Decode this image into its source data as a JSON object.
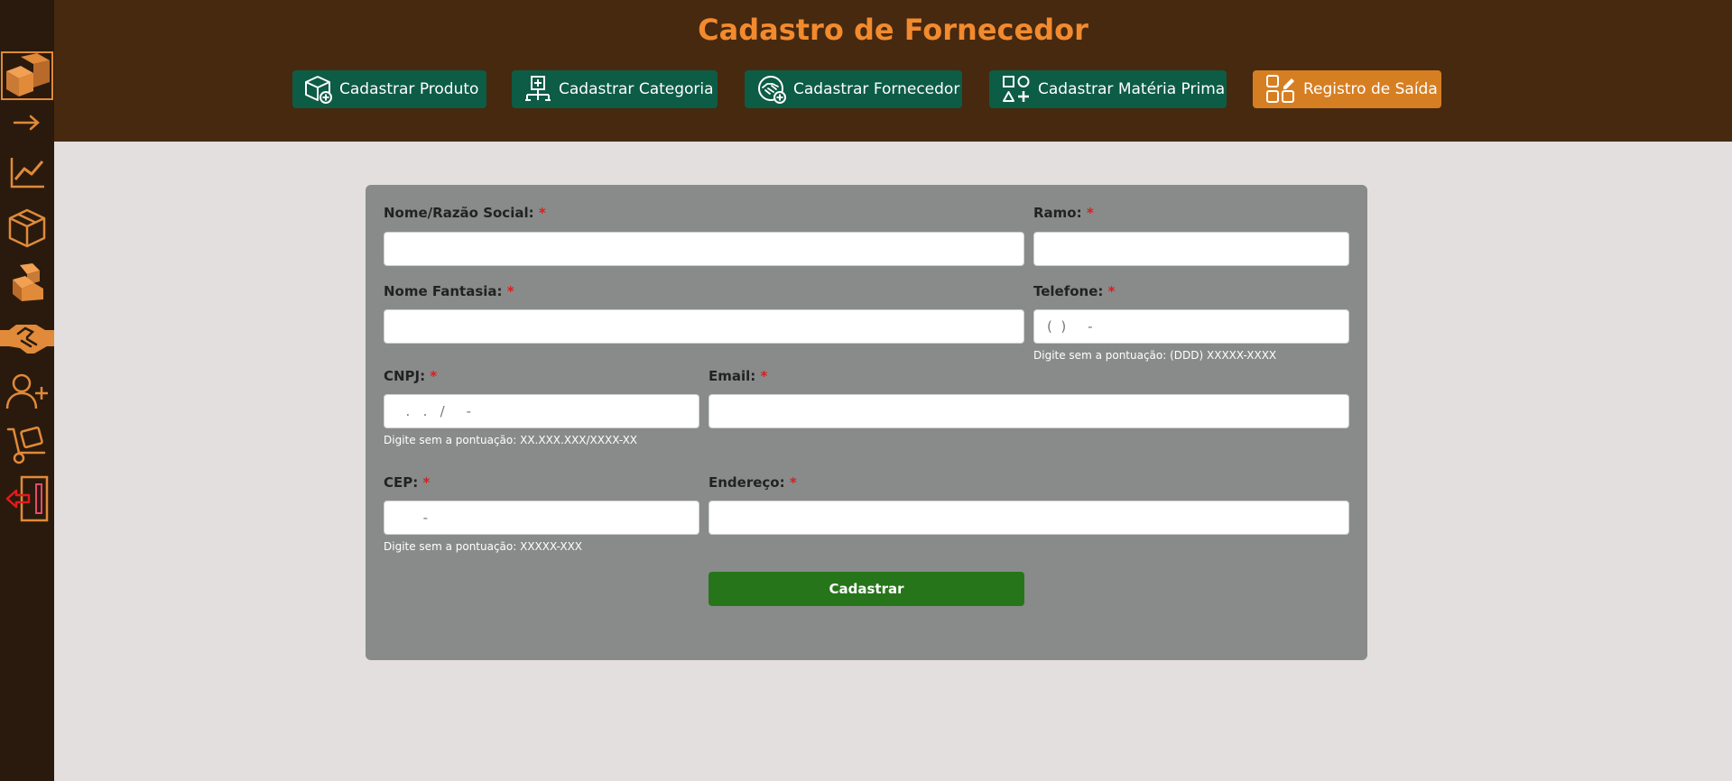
{
  "header": {
    "title": "Cadastro de Fornecedor",
    "nav": [
      {
        "label": "Cadastrar Produto",
        "icon": "box-plus-icon"
      },
      {
        "label": "Cadastrar Categoria",
        "icon": "hierarchy-plus-icon"
      },
      {
        "label": "Cadastrar Fornecedor",
        "icon": "handshake-plus-icon"
      },
      {
        "label": "Cadastrar Matéria Prima",
        "icon": "shapes-plus-icon"
      },
      {
        "label": "Registro de Saída",
        "icon": "grid-edit-icon"
      }
    ]
  },
  "sidebar": {
    "items": [
      {
        "icon": "boxes-logo-icon"
      },
      {
        "icon": "arrow-right-icon"
      },
      {
        "icon": "line-chart-icon"
      },
      {
        "icon": "box-icon"
      },
      {
        "icon": "boxes-stack-icon"
      },
      {
        "icon": "handshake-icon"
      },
      {
        "icon": "user-plus-icon"
      },
      {
        "icon": "hand-truck-icon"
      },
      {
        "icon": "logout-icon"
      }
    ]
  },
  "form": {
    "nome": {
      "label": "Nome/Razão Social:",
      "value": "",
      "placeholder": ""
    },
    "ramo": {
      "label": "Ramo:",
      "value": "",
      "placeholder": ""
    },
    "fantasia": {
      "label": "Nome Fantasia:",
      "value": "",
      "placeholder": ""
    },
    "telefone": {
      "label": "Telefone:",
      "value": "",
      "placeholder": "(  )     -",
      "hint": "Digite sem a pontuação: (DDD) XXXXX-XXXX"
    },
    "cnpj": {
      "label": "CNPJ:",
      "value": "",
      "placeholder": "  .   .   /     -",
      "hint": "Digite sem a pontuação: XX.XXX.XXX/XXXX-XX"
    },
    "email": {
      "label": "Email:",
      "value": "",
      "placeholder": ""
    },
    "cep": {
      "label": "CEP:",
      "value": "",
      "placeholder": "      -",
      "hint": "Digite sem a pontuação: XXXXX-XXX"
    },
    "endereco": {
      "label": "Endereço:",
      "value": "",
      "placeholder": ""
    },
    "required_mark": "*",
    "submit_label": "Cadastrar"
  },
  "colors": {
    "sidebar_bg": "#2a1a0d",
    "header_bg": "#46290f",
    "accent_orange": "#f28a2e",
    "nav_green": "#0d5c45",
    "nav_orange": "#d67f22",
    "card_bg": "#898b8a",
    "submit_green": "#27751a",
    "required_red": "#e01b1b"
  }
}
